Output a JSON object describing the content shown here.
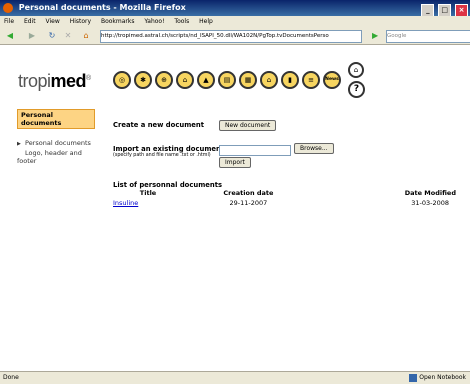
{
  "window": {
    "title": "Personal documents - Mozilla Firefox"
  },
  "menu": [
    "File",
    "Edit",
    "View",
    "History",
    "Bookmarks",
    "Yahoo!",
    "Tools",
    "Help"
  ],
  "url": "http://tropimed.astral.ch/scripts/nd_ISAPI_50.dll/WA102N/PgTop.tvDocumentsPerso",
  "search_placeholder": "Google",
  "logo": {
    "part1": "tropi",
    "part2": "med",
    "mark": "®"
  },
  "sidebar": {
    "section_title": "Personal documents",
    "items": [
      {
        "label": "Personal documents"
      },
      {
        "label": "Logo, header and footer"
      }
    ]
  },
  "create": {
    "label": "Create a new document",
    "button": "New document"
  },
  "import": {
    "label": "Import an existing document",
    "hint": "(specify path and file name .txt or .html)",
    "browse_button": "Browse...",
    "import_button": "Import"
  },
  "list": {
    "title": "List of personnal documents",
    "columns": [
      "Title",
      "Creation date",
      "Date Modified"
    ],
    "rows": [
      {
        "title": "Insuline",
        "created": "29-11-2007",
        "modified": "31-03-2008"
      }
    ]
  },
  "icons": [
    "pills-icon",
    "mosquito-icon",
    "syringe-icon",
    "hospital-icon",
    "mountain-icon",
    "document-icon",
    "map-icon",
    "house-icon",
    "bottle-icon",
    "list-icon",
    "news-icon"
  ],
  "news_label": "News",
  "help_label": "?",
  "status": {
    "text": "Done",
    "notebook": "Open Notebook"
  }
}
